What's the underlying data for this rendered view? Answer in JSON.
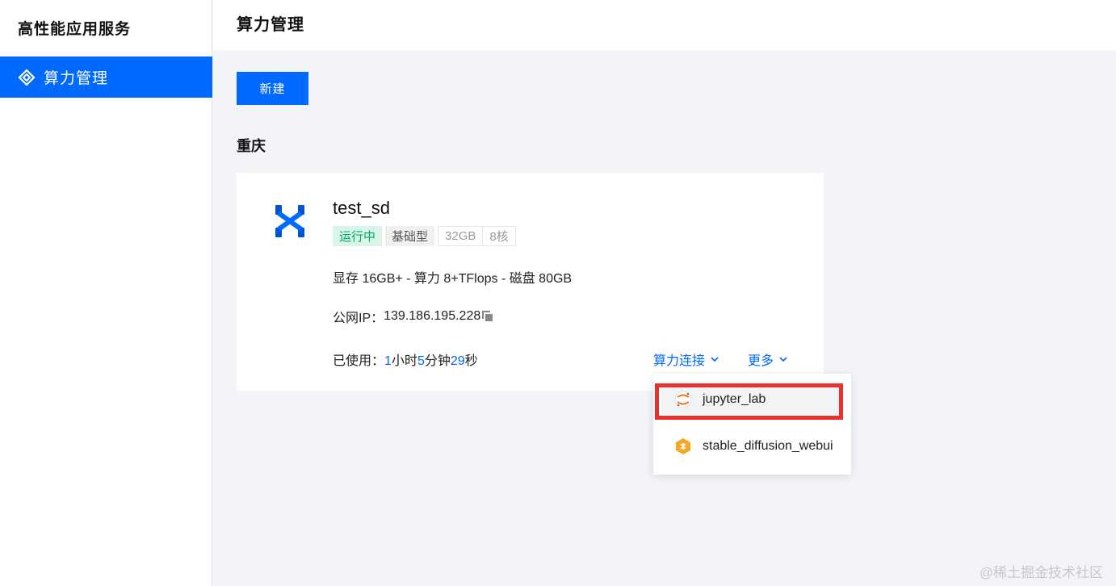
{
  "sidebar": {
    "app_title": "高性能应用服务",
    "items": [
      {
        "label": "算力管理",
        "icon": "layers-icon",
        "active": true
      }
    ]
  },
  "header": {
    "title": "算力管理"
  },
  "toolbar": {
    "new_label": "新建"
  },
  "region": {
    "title": "重庆"
  },
  "instance": {
    "name": "test_sd",
    "status": "运行中",
    "type": "基础型",
    "memory": "32GB",
    "cores": "8核",
    "spec": "显存 16GB+ - 算力 8+TFlops - 磁盘 80GB",
    "ip_label": "公网IP：",
    "ip": "139.186.195.228",
    "usage_label": "已使用：",
    "usage": {
      "hours": "1",
      "hours_unit": "小时",
      "minutes": "5",
      "minutes_unit": "分钟",
      "seconds": "29",
      "seconds_unit": "秒"
    },
    "connect_label": "算力连接",
    "more_label": "更多"
  },
  "dropdown": {
    "items": [
      {
        "label": "jupyter_lab",
        "icon": "jupyter-icon",
        "highlighted": true
      },
      {
        "label": "stable_diffusion_webui",
        "icon": "stable-diffusion-icon",
        "highlighted": false
      }
    ]
  },
  "watermark": "@稀土掘金技术社区",
  "colors": {
    "accent": "#0069ff",
    "running_bg": "#d9f5e8",
    "running_text": "#00a870",
    "highlight_border": "#e8312f"
  }
}
